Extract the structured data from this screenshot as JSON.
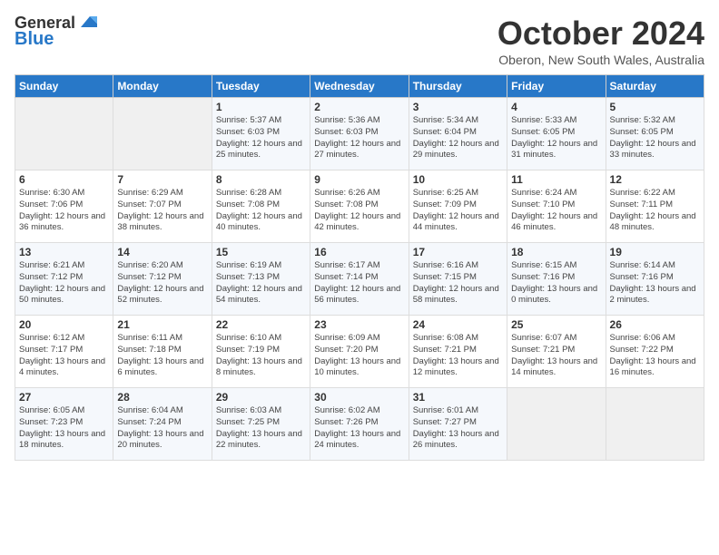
{
  "header": {
    "logo_general": "General",
    "logo_blue": "Blue",
    "month_title": "October 2024",
    "location": "Oberon, New South Wales, Australia"
  },
  "days_of_week": [
    "Sunday",
    "Monday",
    "Tuesday",
    "Wednesday",
    "Thursday",
    "Friday",
    "Saturday"
  ],
  "weeks": [
    [
      {
        "day": "",
        "content": ""
      },
      {
        "day": "",
        "content": ""
      },
      {
        "day": "1",
        "sunrise": "Sunrise: 5:37 AM",
        "sunset": "Sunset: 6:03 PM",
        "daylight": "Daylight: 12 hours and 25 minutes."
      },
      {
        "day": "2",
        "sunrise": "Sunrise: 5:36 AM",
        "sunset": "Sunset: 6:03 PM",
        "daylight": "Daylight: 12 hours and 27 minutes."
      },
      {
        "day": "3",
        "sunrise": "Sunrise: 5:34 AM",
        "sunset": "Sunset: 6:04 PM",
        "daylight": "Daylight: 12 hours and 29 minutes."
      },
      {
        "day": "4",
        "sunrise": "Sunrise: 5:33 AM",
        "sunset": "Sunset: 6:05 PM",
        "daylight": "Daylight: 12 hours and 31 minutes."
      },
      {
        "day": "5",
        "sunrise": "Sunrise: 5:32 AM",
        "sunset": "Sunset: 6:05 PM",
        "daylight": "Daylight: 12 hours and 33 minutes."
      }
    ],
    [
      {
        "day": "6",
        "sunrise": "Sunrise: 6:30 AM",
        "sunset": "Sunset: 7:06 PM",
        "daylight": "Daylight: 12 hours and 36 minutes."
      },
      {
        "day": "7",
        "sunrise": "Sunrise: 6:29 AM",
        "sunset": "Sunset: 7:07 PM",
        "daylight": "Daylight: 12 hours and 38 minutes."
      },
      {
        "day": "8",
        "sunrise": "Sunrise: 6:28 AM",
        "sunset": "Sunset: 7:08 PM",
        "daylight": "Daylight: 12 hours and 40 minutes."
      },
      {
        "day": "9",
        "sunrise": "Sunrise: 6:26 AM",
        "sunset": "Sunset: 7:08 PM",
        "daylight": "Daylight: 12 hours and 42 minutes."
      },
      {
        "day": "10",
        "sunrise": "Sunrise: 6:25 AM",
        "sunset": "Sunset: 7:09 PM",
        "daylight": "Daylight: 12 hours and 44 minutes."
      },
      {
        "day": "11",
        "sunrise": "Sunrise: 6:24 AM",
        "sunset": "Sunset: 7:10 PM",
        "daylight": "Daylight: 12 hours and 46 minutes."
      },
      {
        "day": "12",
        "sunrise": "Sunrise: 6:22 AM",
        "sunset": "Sunset: 7:11 PM",
        "daylight": "Daylight: 12 hours and 48 minutes."
      }
    ],
    [
      {
        "day": "13",
        "sunrise": "Sunrise: 6:21 AM",
        "sunset": "Sunset: 7:12 PM",
        "daylight": "Daylight: 12 hours and 50 minutes."
      },
      {
        "day": "14",
        "sunrise": "Sunrise: 6:20 AM",
        "sunset": "Sunset: 7:12 PM",
        "daylight": "Daylight: 12 hours and 52 minutes."
      },
      {
        "day": "15",
        "sunrise": "Sunrise: 6:19 AM",
        "sunset": "Sunset: 7:13 PM",
        "daylight": "Daylight: 12 hours and 54 minutes."
      },
      {
        "day": "16",
        "sunrise": "Sunrise: 6:17 AM",
        "sunset": "Sunset: 7:14 PM",
        "daylight": "Daylight: 12 hours and 56 minutes."
      },
      {
        "day": "17",
        "sunrise": "Sunrise: 6:16 AM",
        "sunset": "Sunset: 7:15 PM",
        "daylight": "Daylight: 12 hours and 58 minutes."
      },
      {
        "day": "18",
        "sunrise": "Sunrise: 6:15 AM",
        "sunset": "Sunset: 7:16 PM",
        "daylight": "Daylight: 13 hours and 0 minutes."
      },
      {
        "day": "19",
        "sunrise": "Sunrise: 6:14 AM",
        "sunset": "Sunset: 7:16 PM",
        "daylight": "Daylight: 13 hours and 2 minutes."
      }
    ],
    [
      {
        "day": "20",
        "sunrise": "Sunrise: 6:12 AM",
        "sunset": "Sunset: 7:17 PM",
        "daylight": "Daylight: 13 hours and 4 minutes."
      },
      {
        "day": "21",
        "sunrise": "Sunrise: 6:11 AM",
        "sunset": "Sunset: 7:18 PM",
        "daylight": "Daylight: 13 hours and 6 minutes."
      },
      {
        "day": "22",
        "sunrise": "Sunrise: 6:10 AM",
        "sunset": "Sunset: 7:19 PM",
        "daylight": "Daylight: 13 hours and 8 minutes."
      },
      {
        "day": "23",
        "sunrise": "Sunrise: 6:09 AM",
        "sunset": "Sunset: 7:20 PM",
        "daylight": "Daylight: 13 hours and 10 minutes."
      },
      {
        "day": "24",
        "sunrise": "Sunrise: 6:08 AM",
        "sunset": "Sunset: 7:21 PM",
        "daylight": "Daylight: 13 hours and 12 minutes."
      },
      {
        "day": "25",
        "sunrise": "Sunrise: 6:07 AM",
        "sunset": "Sunset: 7:21 PM",
        "daylight": "Daylight: 13 hours and 14 minutes."
      },
      {
        "day": "26",
        "sunrise": "Sunrise: 6:06 AM",
        "sunset": "Sunset: 7:22 PM",
        "daylight": "Daylight: 13 hours and 16 minutes."
      }
    ],
    [
      {
        "day": "27",
        "sunrise": "Sunrise: 6:05 AM",
        "sunset": "Sunset: 7:23 PM",
        "daylight": "Daylight: 13 hours and 18 minutes."
      },
      {
        "day": "28",
        "sunrise": "Sunrise: 6:04 AM",
        "sunset": "Sunset: 7:24 PM",
        "daylight": "Daylight: 13 hours and 20 minutes."
      },
      {
        "day": "29",
        "sunrise": "Sunrise: 6:03 AM",
        "sunset": "Sunset: 7:25 PM",
        "daylight": "Daylight: 13 hours and 22 minutes."
      },
      {
        "day": "30",
        "sunrise": "Sunrise: 6:02 AM",
        "sunset": "Sunset: 7:26 PM",
        "daylight": "Daylight: 13 hours and 24 minutes."
      },
      {
        "day": "31",
        "sunrise": "Sunrise: 6:01 AM",
        "sunset": "Sunset: 7:27 PM",
        "daylight": "Daylight: 13 hours and 26 minutes."
      },
      {
        "day": "",
        "content": ""
      },
      {
        "day": "",
        "content": ""
      }
    ]
  ]
}
